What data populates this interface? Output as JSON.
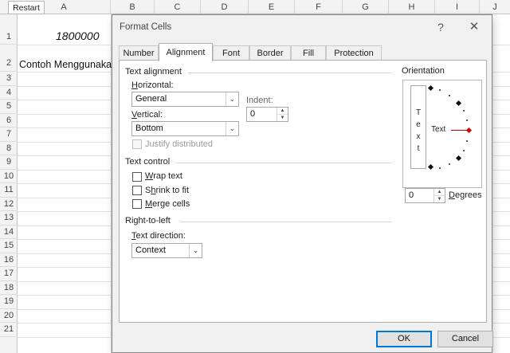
{
  "sheet": {
    "restart_label": "Restart",
    "columns": [
      "A",
      "B",
      "C",
      "D",
      "E",
      "F",
      "G",
      "H",
      "I",
      "J"
    ],
    "rows": [
      "1",
      "2",
      "3",
      "4",
      "5",
      "6",
      "7",
      "8",
      "9",
      "10",
      "11",
      "12",
      "13",
      "14",
      "15",
      "16",
      "17",
      "18",
      "19",
      "20",
      "21"
    ],
    "cells": {
      "a1": "1800000",
      "a2": "Contoh Menggunakan"
    }
  },
  "dialog": {
    "title": "Format Cells",
    "help_glyph": "?",
    "close_glyph": "✕",
    "tabs": [
      "Number",
      "Alignment",
      "Font",
      "Border",
      "Fill",
      "Protection"
    ],
    "active_tab": "Alignment",
    "text_alignment": {
      "heading": "Text alignment",
      "horizontal_label": "Horizontal:",
      "horizontal_value": "General",
      "vertical_label": "Vertical:",
      "vertical_value": "Bottom",
      "indent_label": "Indent:",
      "indent_value": "0",
      "justify_distributed_label": "Justify distributed",
      "justify_distributed_checked": false,
      "justify_distributed_enabled": false
    },
    "text_control": {
      "heading": "Text control",
      "wrap_text_label": "Wrap text",
      "wrap_text_checked": false,
      "shrink_to_fit_label": "Shrink to fit",
      "shrink_to_fit_checked": false,
      "merge_cells_label": "Merge cells",
      "merge_cells_checked": false
    },
    "right_to_left": {
      "heading": "Right-to-left",
      "text_direction_label": "Text direction:",
      "text_direction_value": "Context"
    },
    "orientation": {
      "heading": "Orientation",
      "vertical_text_chars": [
        "T",
        "e",
        "x",
        "t"
      ],
      "dial_text": "Text",
      "degrees_value": "0",
      "degrees_label": "Degrees",
      "indicator_color": "#c00000"
    },
    "buttons": {
      "ok": "OK",
      "cancel": "Cancel"
    },
    "dropdown_arrow": "⌄",
    "spin_up": "▲",
    "spin_down": "▼"
  }
}
